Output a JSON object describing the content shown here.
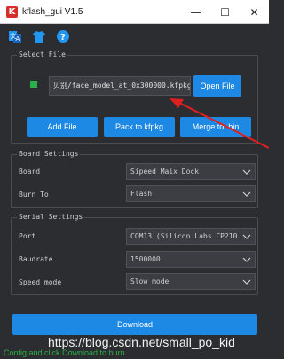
{
  "window": {
    "title": "kflash_gui V1.5",
    "app_icon_letter": "K",
    "minimize": "—",
    "maximize": "☐",
    "close": "✕"
  },
  "toolbar": {
    "icons": [
      "language-icon",
      "shirt-icon",
      "help-icon"
    ]
  },
  "select_file": {
    "group_title": "Select File",
    "file_path": "贝别/face_model_at_0x300000.kfpkg",
    "open_file_label": "Open File",
    "add_file_label": "Add File",
    "pack_label": "Pack to kfpkg",
    "merge_label": "Merge to .bin"
  },
  "board_settings": {
    "group_title": "Board Settings",
    "board_label": "Board",
    "board_value": "Sipeed Maix Dock",
    "burn_to_label": "Burn To",
    "burn_to_value": "Flash"
  },
  "serial_settings": {
    "group_title": "Serial Settings",
    "port_label": "Port",
    "port_value": "COM13 (Silicon Labs CP210",
    "baudrate_label": "Baudrate",
    "baudrate_value": "1500000",
    "speed_mode_label": "Speed mode",
    "speed_mode_value": "Slow mode"
  },
  "download": {
    "label": "Download"
  },
  "watermark": {
    "text": "https://blog.csdn.net/small_po_kid"
  },
  "status": {
    "text": "Config and click Download to burn"
  },
  "colors": {
    "accent": "#1e88e5",
    "background": "#2b2d31",
    "status_green": "#2bb14a",
    "annotation_red": "#e02020"
  }
}
